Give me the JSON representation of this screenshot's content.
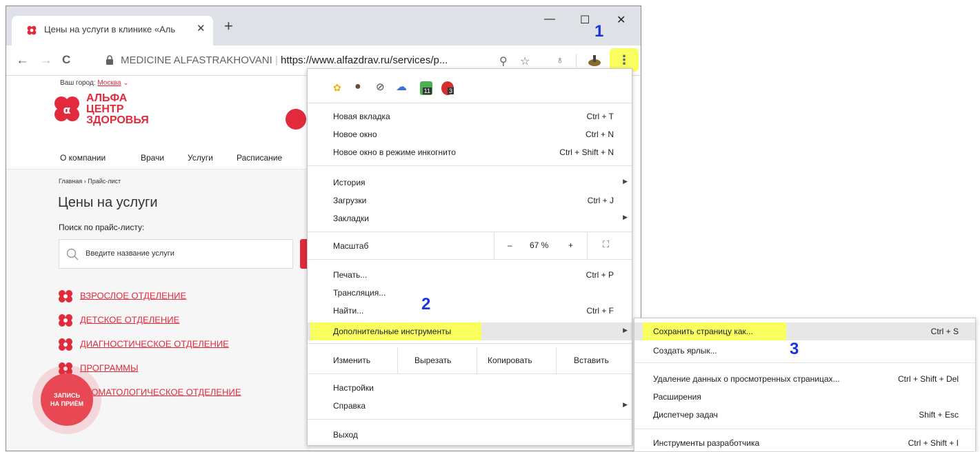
{
  "browser": {
    "tab_title": "Цены на услуги в клинике «Аль",
    "tab_close": "✕",
    "new_tab": "+",
    "minimize": "—",
    "maximize": "☐",
    "close": "✕",
    "back": "←",
    "forward": "→",
    "reload": "C",
    "site_name": "MEDICINE ALFASTRAKHOVANI",
    "url": "https://www.alfazdrav.ru/services/p...",
    "menu_icon": "⋮",
    "icons": [
      "lock-icon",
      "zoom-icon",
      "star-icon",
      "extension-icon",
      "avatar-icon",
      "kebab-menu-icon"
    ]
  },
  "page": {
    "city_label": "Ваш город:",
    "city": "Москва",
    "logo_lines": [
      "АЛЬФА",
      "ЦЕНТР",
      "ЗДОРОВЬЯ"
    ],
    "nav": [
      "О компании",
      "Врачи",
      "Услуги",
      "Расписание"
    ],
    "breadcrumb": "Главная › Прайс-лист",
    "title": "Цены на услуги",
    "search_label": "Поиск по прайс-листу:",
    "search_placeholder": "Введите название услуги",
    "categories": [
      "ВЗРОСЛОЕ ОТДЕЛЕНИЕ",
      "ДЕТСКОЕ ОТДЕЛЕНИЕ",
      "ДИАГНОСТИЧЕСКОЕ ОТДЕЛЕНИЕ",
      "ПРОГРАММЫ",
      "СТОМАТОЛОГИЧЕСКОЕ ОТДЕЛЕНИЕ"
    ],
    "fab_line1": "ЗАПИСЬ",
    "fab_line2": "НА ПРИЁМ",
    "brand_color": "#e12b3c"
  },
  "menu": {
    "extension_badges": [
      "11",
      "3"
    ],
    "new_tab": {
      "label": "Новая вкладка",
      "shortcut": "Ctrl + T"
    },
    "new_window": {
      "label": "Новое окно",
      "shortcut": "Ctrl + N"
    },
    "incognito": {
      "label": "Новое окно в режиме инкогнито",
      "shortcut": "Ctrl + Shift + N"
    },
    "history": {
      "label": "История"
    },
    "downloads": {
      "label": "Загрузки",
      "shortcut": "Ctrl + J"
    },
    "bookmarks": {
      "label": "Закладки"
    },
    "zoom": {
      "label": "Масштаб",
      "minus": "–",
      "value": "67 %",
      "plus": "+"
    },
    "print": {
      "label": "Печать...",
      "shortcut": "Ctrl + P"
    },
    "cast": {
      "label": "Трансляция..."
    },
    "find": {
      "label": "Найти...",
      "shortcut": "Ctrl + F"
    },
    "more_tools": {
      "label": "Дополнительные инструменты"
    },
    "edit": {
      "label": "Изменить",
      "cut": "Вырезать",
      "copy": "Копировать",
      "paste": "Вставить"
    },
    "settings": {
      "label": "Настройки"
    },
    "help": {
      "label": "Справка"
    },
    "exit": {
      "label": "Выход"
    }
  },
  "submenu": {
    "save_page": {
      "label": "Сохранить страницу как...",
      "shortcut": "Ctrl + S"
    },
    "create_shortcut": {
      "label": "Создать ярлык..."
    },
    "clear_data": {
      "label": "Удаление данных о просмотренных страницах...",
      "shortcut": "Ctrl + Shift + Del"
    },
    "extensions": {
      "label": "Расширения"
    },
    "task_manager": {
      "label": "Диспетчер задач",
      "shortcut": "Shift + Esc"
    },
    "dev_tools": {
      "label": "Инструменты разработчика",
      "shortcut": "Ctrl + Shift + I"
    }
  },
  "annotations": {
    "step1": "1",
    "step2": "2",
    "step3": "3",
    "highlight_color": "#f9ff5e",
    "step_color": "#1a35e0"
  }
}
